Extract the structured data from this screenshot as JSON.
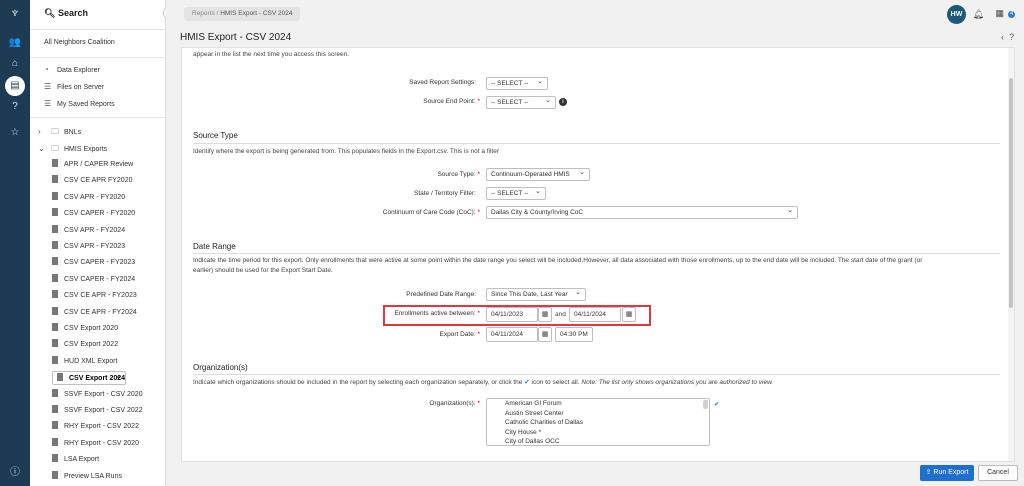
{
  "rail": {
    "icons": [
      "logo-icon",
      "users-icon",
      "home-icon",
      "document-icon",
      "help-icon",
      "star-icon",
      "question-circle-icon"
    ]
  },
  "sidebar": {
    "search_label": "Search",
    "org_name": "All Neighbors Coalition",
    "links": [
      {
        "label": "Data Explorer",
        "icon": "chart-icon"
      },
      {
        "label": "Files on Server",
        "icon": "list-icon"
      },
      {
        "label": "My Saved Reports",
        "icon": "list-icon"
      }
    ],
    "folders": [
      {
        "label": "BNLs"
      },
      {
        "label": "HMIS Exports"
      }
    ],
    "reports": [
      "APR / CAPER Review",
      "CSV CE APR FY2020",
      "CSV APR - FY2020",
      "CSV CAPER - FY2020",
      "CSV APR - FY2024",
      "CSV APR - FY2023",
      "CSV CAPER - FY2023",
      "CSV CAPER - FY2024",
      "CSV CE APR - FY2023",
      "CSV CE APR - FY2024",
      "CSV Export 2020",
      "CSV Export 2022",
      "HUD XML Export",
      "CSV Export 2024",
      "SSVF Export - CSV 2020",
      "SSVF Export - CSV 2022",
      "RHY Export - CSV 2022",
      "RHY Export - CSV 2020",
      "LSA Export",
      "Preview LSA Runs"
    ],
    "selected_index": 13
  },
  "topbar": {
    "breadcrumb_root": "Reports",
    "breadcrumb_sep": "/",
    "breadcrumb_current": "HMIS Export - CSV 2024",
    "avatar_initials": "HW",
    "badge_count": "4"
  },
  "page": {
    "title": "HMIS Export - CSV 2024",
    "top_text": "appear in the list the next time you access this screen.",
    "saved_settings_label": "Saved Report Settings:",
    "saved_settings_value": "-- SELECT --",
    "endpoint_label": "Source End Point:",
    "endpoint_value": "-- SELECT --",
    "source_type_heading": "Source Type",
    "source_type_desc": "Identify where the export is being generated from. This populates fields in the Export.csv. This is not a filter",
    "source_type_label": "Source Type:",
    "source_type_value": "Continuum-Operated HMIS",
    "state_label": "State / Territory Filter:",
    "state_value": "-- SELECT --",
    "coc_label": "Continuum of Care Code (CoC):",
    "coc_value": "Dallas City & County/Irving CoC",
    "date_range_heading": "Date Range",
    "date_range_desc_1": "Indicate the time period for this export. Only enrollments that were active at some point within the date range you select will be included.However, all data associated with those enrollments, up to the end date will be included. The start date of the grant (or",
    "date_range_desc_2": "earlier) should be used for the Export Start Date.",
    "predefined_label": "Predefined Date Range:",
    "predefined_value": "Since This Date, Last Year",
    "enrollments_label": "Enrollments active between:",
    "start_date": "04/11/2023",
    "and_text": "and",
    "end_date": "04/11/2024",
    "export_date_label": "Export Date:",
    "export_date": "04/11/2024",
    "export_time": "04:30 PM",
    "org_heading": "Organization(s)",
    "org_desc_1": "Indicate which organizations should be included in the report by selecting each organization separately, or click the",
    "org_desc_2": "icon to select all.",
    "org_note": "Note: The list only shows organizations you are authorized to view.",
    "org_label": "Organization(s):",
    "organizations": [
      "American GI Forum",
      "Austin Street Center",
      "Catholic Charities of Dallas",
      "City House *",
      "City of Dallas OCC"
    ]
  },
  "footer": {
    "run_label": "Run Export",
    "cancel_label": "Cancel"
  }
}
